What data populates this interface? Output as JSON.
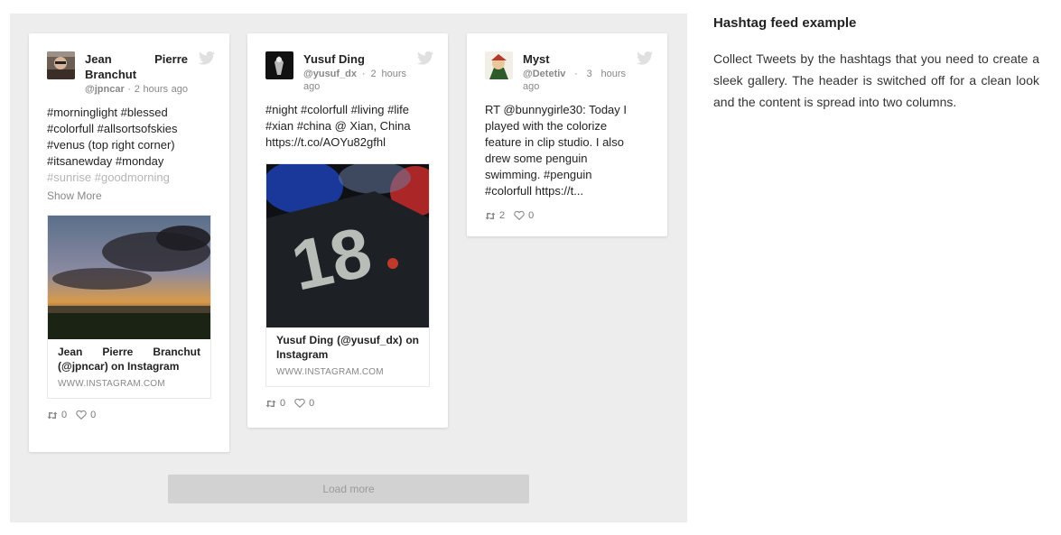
{
  "feed": {
    "posts": [
      {
        "author": "Jean Pierre Branchut",
        "handle": "@jpncar",
        "time": "· 2 hours ago",
        "text_lines": [
          "#morninglight #blessed",
          "#colorfull #allsortsofskies",
          "#venus (top right corner)",
          "#itsanewday #monday",
          "#sunrise #goodmorning"
        ],
        "show_more": "Show More",
        "media_title": "Jean Pierre Branchut (@jpncar) on Instagram",
        "media_source": "WWW.INSTAGRAM.COM",
        "retweets": "0",
        "likes": "0"
      },
      {
        "author": "Yusuf Ding",
        "handle": "@yusuf_dx",
        "time": "· 2 hours ago",
        "text_lines": [
          "#night #colorfull #living #life",
          "#xian #china @ Xian, China",
          "https://t.co/AOYu82gfhl"
        ],
        "media_title": "Yusuf Ding (@yusuf_dx) on Instagram",
        "media_source": "WWW.INSTAGRAM.COM",
        "retweets": "0",
        "likes": "0"
      },
      {
        "author": "Myst",
        "handle": "@Detetiv",
        "time": "· 3 hours ago",
        "text_lines": [
          "RT @bunnygirle30: Today I",
          "played with the colorize",
          "feature in clip studio. I also",
          "drew some penguin",
          "swimming. #penguin",
          "#colorfull https://t..."
        ],
        "retweets": "2",
        "likes": "0"
      }
    ],
    "load_more": "Load more"
  },
  "sidebar": {
    "title": "Hashtag feed example",
    "description": "Collect Tweets by the hashtags that you need to create a sleek gallery. The header is switched off for a clean look and the content is spread into two columns."
  },
  "colors": {
    "panel_bg": "#ededed",
    "card_bg": "#ffffff",
    "muted_text": "#888888",
    "button_bg": "#d2d2d2"
  },
  "icons": {
    "twitter": "twitter-bird-icon",
    "retweet": "retweet-icon",
    "like": "heart-icon"
  }
}
